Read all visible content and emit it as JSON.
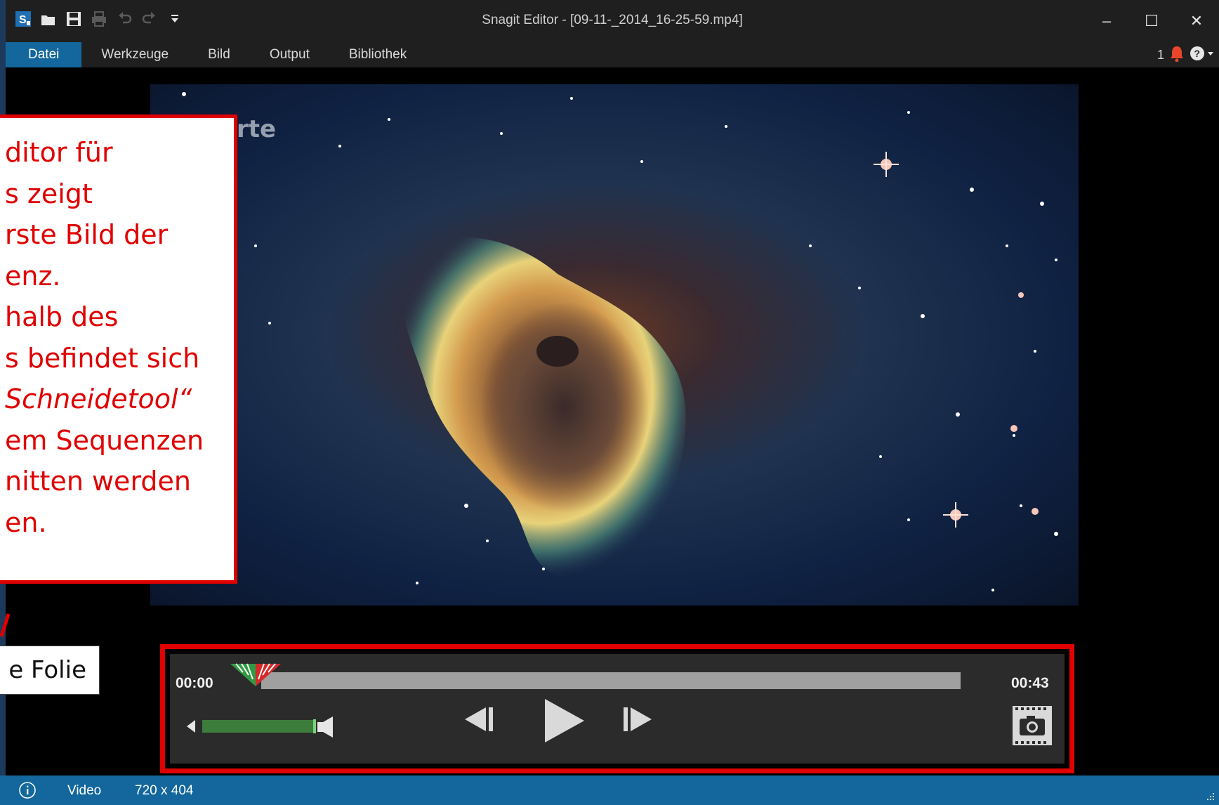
{
  "window": {
    "title": "Snagit Editor - [09-11-_2014_16-25-59.mp4]",
    "controls": {
      "minimize": "–",
      "maximize": "☐",
      "close": "✕"
    }
  },
  "quick_access": {
    "icons": [
      "snagit-logo-icon",
      "open-folder-icon",
      "save-icon",
      "print-icon",
      "undo-icon",
      "redo-icon",
      "customize-dropdown-icon"
    ]
  },
  "menu": {
    "items": [
      {
        "label": "Datei",
        "active": true
      },
      {
        "label": "Werkzeuge"
      },
      {
        "label": "Bild"
      },
      {
        "label": "Output"
      },
      {
        "label": "Bibliothek"
      }
    ],
    "notification_count": "1",
    "icons": [
      "bell-icon",
      "help-icon"
    ]
  },
  "video": {
    "watermark": "arte"
  },
  "callout": {
    "lines": [
      "ditor für",
      "s zeigt",
      "rste Bild der",
      "enz.",
      "halb des",
      "s befindet sich",
      "Schneidetool“",
      "em Sequenzen",
      "nitten werden",
      "en."
    ],
    "italic_line_index": 6,
    "border_color": "#e00000",
    "text_color": "#e00000"
  },
  "folie_label": "e Folie",
  "player": {
    "current_time": "00:00",
    "total_time": "00:43",
    "volume_level": 0.9,
    "buttons": [
      "previous-frame-button",
      "play-button",
      "next-frame-button",
      "snapshot-button"
    ]
  },
  "status": {
    "type": "Video",
    "dimensions": "720 x 404"
  },
  "colors": {
    "accent": "#13679c",
    "titlebar": "#1f1f1f",
    "highlight": "#e00000"
  }
}
